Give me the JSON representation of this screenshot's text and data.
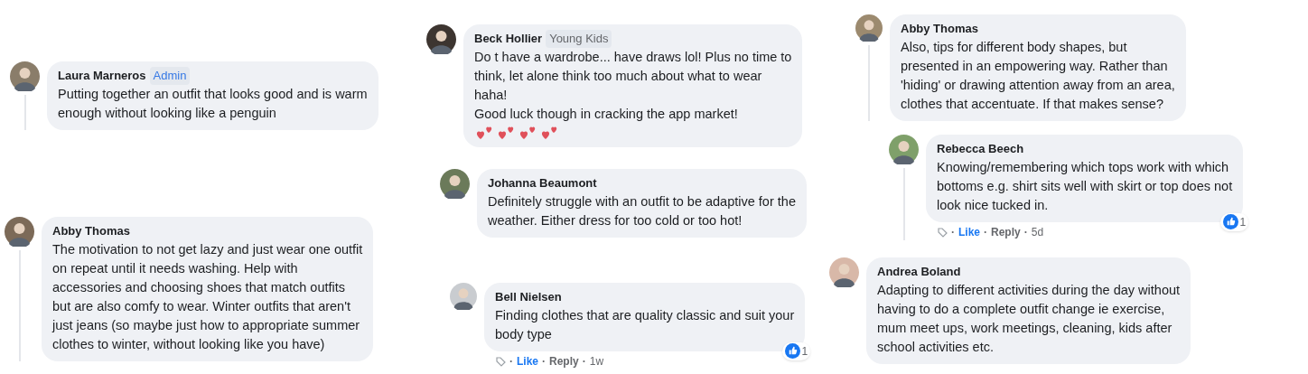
{
  "comments": [
    {
      "name": "Laura Marneros",
      "badge": {
        "text": "Admin",
        "kind": "admin"
      },
      "text": "Putting together an outfit that looks good and is warm\nenough without looking like a penguin",
      "thread_line": true
    },
    {
      "name": "Abby Thomas",
      "text": "The motivation to not get lazy and just wear one outfit\non repeat until it needs washing. Help with\naccessories and choosing shoes that match outfits\nbut are also comfy to wear. Winter outfits that aren't\njust jeans (so maybe just how to appropriate summer\nclothes to winter, without looking like you have)",
      "thread_line": true
    },
    {
      "name": "Beck Hollier",
      "badge": {
        "text": "Young Kids",
        "kind": "group"
      },
      "text": "Do t have a wardrobe... have draws lol! Plus no time to\nthink, let alone think too much about what to wear\nhaha!\nGood luck though in cracking the app market!",
      "emoji": [
        {
          "kind": "two-hearts"
        },
        {
          "kind": "two-hearts"
        },
        {
          "kind": "two-hearts"
        },
        {
          "kind": "two-hearts"
        }
      ],
      "thread_line": false
    },
    {
      "name": "Johanna Beaumont",
      "text": "Definitely struggle with an outfit to be adaptive for the\nweather. Either dress for too cold or too hot!",
      "thread_line": false
    },
    {
      "name": "Bell Nielsen",
      "text": "Finding clothes that are quality classic and suit your\nbody type",
      "footer": {
        "separator": "·",
        "like": "Like",
        "reply": "Reply",
        "time": "1w"
      },
      "reactions": {
        "count": "1"
      },
      "thread_line": false
    },
    {
      "name": "Abby Thomas",
      "text": "Also, tips for different body shapes, but\npresented in an empowering way. Rather than\n'hiding' or drawing attention away from an area,\nclothes that accentuate. If that makes sense?",
      "thread_line": true
    },
    {
      "name": "Rebecca Beech",
      "text": "Knowing/remembering which tops work with which\nbottoms e.g. shirt sits well with skirt or top does not\nlook nice tucked in.",
      "footer": {
        "separator": "·",
        "like": "Like",
        "reply": "Reply",
        "time": "5d"
      },
      "reactions": {
        "count": "1"
      },
      "thread_line": true
    },
    {
      "name": "Andrea Boland",
      "text": "Adapting to different activities during the day without\nhaving to do a complete outfit change ie exercise,\nmum meet ups, work meetings, cleaning, kids after\nschool activities etc.",
      "thread_line": false
    }
  ]
}
